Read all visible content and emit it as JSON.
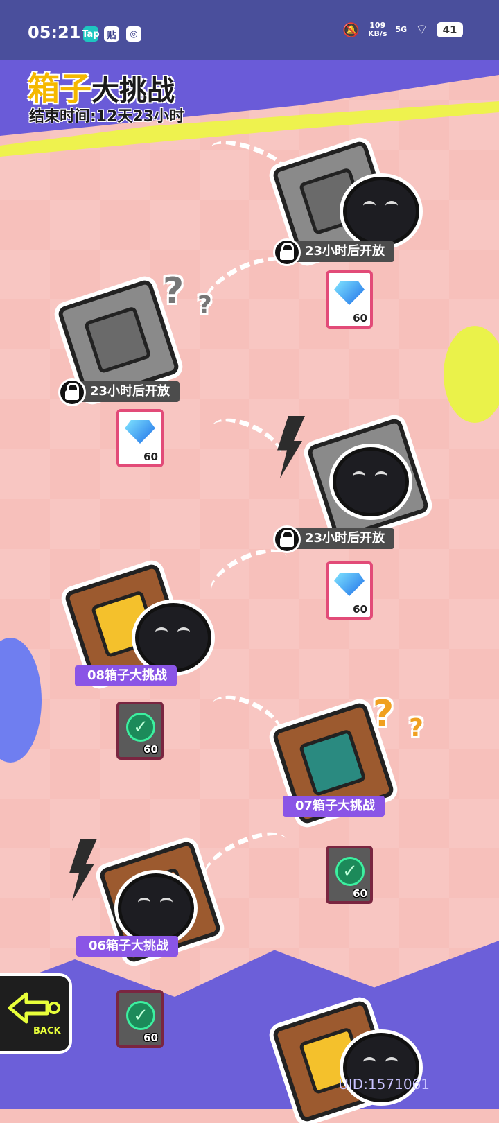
{
  "status_bar": {
    "time": "05:21",
    "apps": [
      "Tap",
      "贴",
      "◎"
    ],
    "net_speed_value": "109",
    "net_speed_unit": "KB/s",
    "signal": "5G",
    "battery": "41"
  },
  "header": {
    "title_accent": "箱子",
    "title_rest": "大挑战",
    "end_time": "结束时间:12天23小时"
  },
  "levels": [
    {
      "label": "23小时后开放",
      "state": "locked",
      "reward_count": "60"
    },
    {
      "label": "23小时后开放",
      "state": "locked",
      "reward_count": "60"
    },
    {
      "label": "23小时后开放",
      "state": "locked",
      "reward_count": "60"
    },
    {
      "label": "08箱子大挑战",
      "state": "completed",
      "reward_count": "60"
    },
    {
      "label": "07箱子大挑战",
      "state": "completed",
      "reward_count": "60"
    },
    {
      "label": "06箱子大挑战",
      "state": "completed",
      "reward_count": "60"
    }
  ],
  "question_mark": "?",
  "back_button": {
    "label": "BACK"
  },
  "uid": "UID:1571061",
  "colors": {
    "background": "#f7c0bb",
    "status_bar": "#4a4f9c",
    "locked_label": "#4c4c4c",
    "done_label": "#8a55e6",
    "reward_border": "#e24b78",
    "accent_yellow": "#f5b800"
  }
}
